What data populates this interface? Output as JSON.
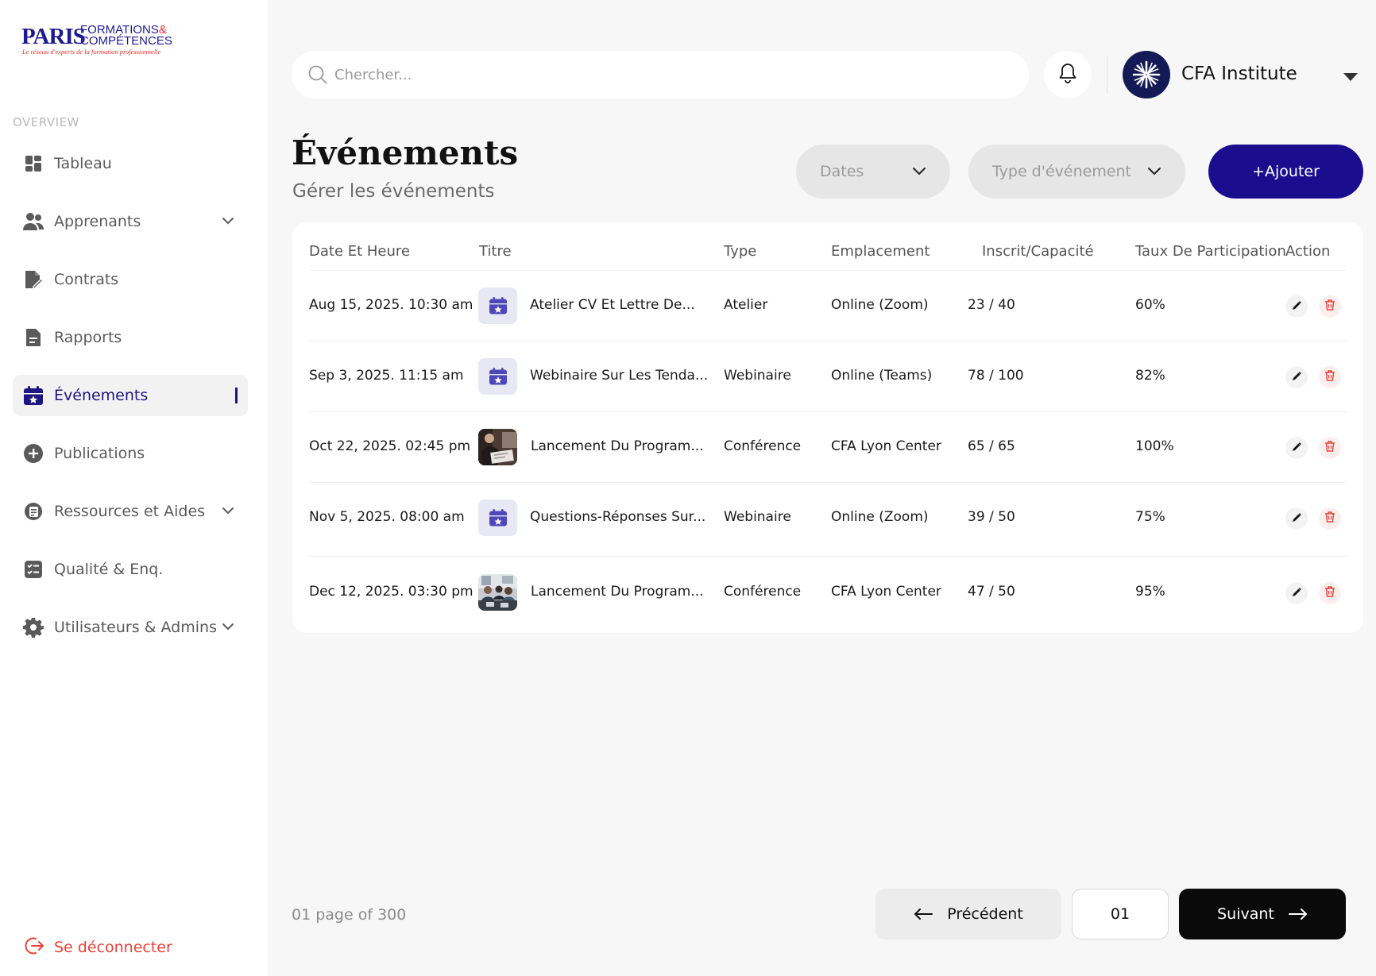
{
  "brand": {
    "name_main": "PARIS",
    "name_line1": "FORMATIONS",
    "name_amp": "&",
    "name_line2": "COMPÉTENCES",
    "tagline": "Le réseau d'experts de la formation professionnelle",
    "color": "#1d1a8f",
    "accent": "#d9302b"
  },
  "sidebar": {
    "section": "OVERVIEW",
    "items": [
      {
        "label": "Tableau",
        "icon": "grid-icon",
        "expandable": false
      },
      {
        "label": "Apprenants",
        "icon": "users-icon",
        "expandable": true
      },
      {
        "label": "Contrats",
        "icon": "contract-icon",
        "expandable": false
      },
      {
        "label": "Rapports",
        "icon": "report-icon",
        "expandable": false
      },
      {
        "label": "Événements",
        "icon": "calendar-star-icon",
        "expandable": false,
        "active": true
      },
      {
        "label": "Publications",
        "icon": "plus-circle-icon",
        "expandable": false
      },
      {
        "label": "Ressources et Aides",
        "icon": "resources-icon",
        "expandable": true
      },
      {
        "label": "Qualité & Enq.",
        "icon": "checklist-icon",
        "expandable": false
      },
      {
        "label": "Utilisateurs & Admins",
        "icon": "gear-icon",
        "expandable": true
      }
    ],
    "logout": "Se déconnecter"
  },
  "topbar": {
    "search_placeholder": "Chercher...",
    "org_name": "CFA Institute"
  },
  "header": {
    "title": "Événements",
    "subtitle": "Gérer les événements",
    "filter_dates": "Dates",
    "filter_type": "Type d'événement",
    "add_label": "+Ajouter"
  },
  "table": {
    "columns": [
      "Date Et Heure",
      "Titre",
      "Type",
      "Emplacement",
      "Inscrit/Capacité",
      "Taux De Participation",
      "Action"
    ],
    "rows": [
      {
        "date": "Aug 15, 2025. 10:30 am",
        "thumb": "calendar-icon",
        "title": "Atelier CV Et Lettre De...",
        "type": "Atelier",
        "location": "Online (Zoom)",
        "registered": "23 / 40",
        "rate": "60%"
      },
      {
        "date": "Sep 3, 2025. 11:15 am",
        "thumb": "calendar-icon",
        "title": "Webinaire Sur Les Tenda...",
        "type": "Webinaire",
        "location": "Online (Teams)",
        "registered": "78 / 100",
        "rate": "82%"
      },
      {
        "date": "Oct 22, 2025. 02:45 pm",
        "thumb": "photo-meeting",
        "title": "Lancement Du Program...",
        "type": "Conférence",
        "location": "CFA Lyon Center",
        "registered": "65 / 65",
        "rate": "100%"
      },
      {
        "date": "Nov 5, 2025. 08:00 am",
        "thumb": "calendar-icon",
        "title": "Questions-Réponses Sur...",
        "type": "Webinaire",
        "location": "Online (Zoom)",
        "registered": "39 / 50",
        "rate": "75%"
      },
      {
        "date": "Dec 12, 2025. 03:30 pm",
        "thumb": "photo-team",
        "title": "Lancement Du Program...",
        "type": "Conférence",
        "location": "CFA Lyon Center",
        "registered": "47 / 50",
        "rate": "95%"
      }
    ]
  },
  "pagination": {
    "info": "01 page of 300",
    "prev_label": "Précédent",
    "current": "01",
    "next_label": "Suivant"
  },
  "colors": {
    "primary": "#1a0e8f",
    "danger": "#e8423a",
    "background": "#f7f7f7"
  }
}
